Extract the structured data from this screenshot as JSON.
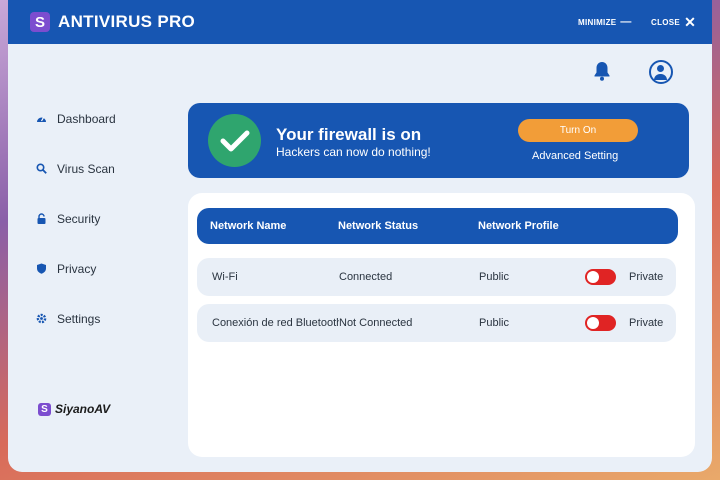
{
  "app": {
    "logo_letter": "S",
    "title": "ANTIVIRUS PRO",
    "accent": "#1756b2",
    "logo_color": "#7c4dcf"
  },
  "window_controls": {
    "minimize": "MINIMIZE",
    "minimize_icon": "minus-icon",
    "close": "CLOSE",
    "close_icon": "close-icon"
  },
  "header_icons": [
    "bell-icon",
    "user-avatar-icon"
  ],
  "sidebar": {
    "items": [
      {
        "label": "Dashboard",
        "icon": "dashboard-icon"
      },
      {
        "label": "Virus Scan",
        "icon": "search-icon"
      },
      {
        "label": "Security",
        "icon": "lock-icon"
      },
      {
        "label": "Privacy",
        "icon": "shield-icon"
      },
      {
        "label": "Settings",
        "icon": "gear-icon"
      }
    ],
    "brand_letter": "S",
    "brand": "SiyanoAV"
  },
  "banner": {
    "title": "Your firewall is on",
    "subtitle": "Hackers can now do nothing!",
    "turn_on_label": "Turn On",
    "advanced_label": "Advanced Setting",
    "status_icon": "checkmark-icon",
    "status_color": "#2fa56e"
  },
  "table": {
    "headers": [
      "Network Name",
      "Network Status",
      "Network Profile"
    ],
    "rows": [
      {
        "name": "Wi-Fi",
        "status": "Connected",
        "profile": "Public",
        "toggle_label": "Private",
        "toggle_on": false
      },
      {
        "name": "Conexión de red Bluetooth",
        "status": "Not Connected",
        "profile": "Public",
        "toggle_label": "Private",
        "toggle_on": false
      }
    ]
  }
}
